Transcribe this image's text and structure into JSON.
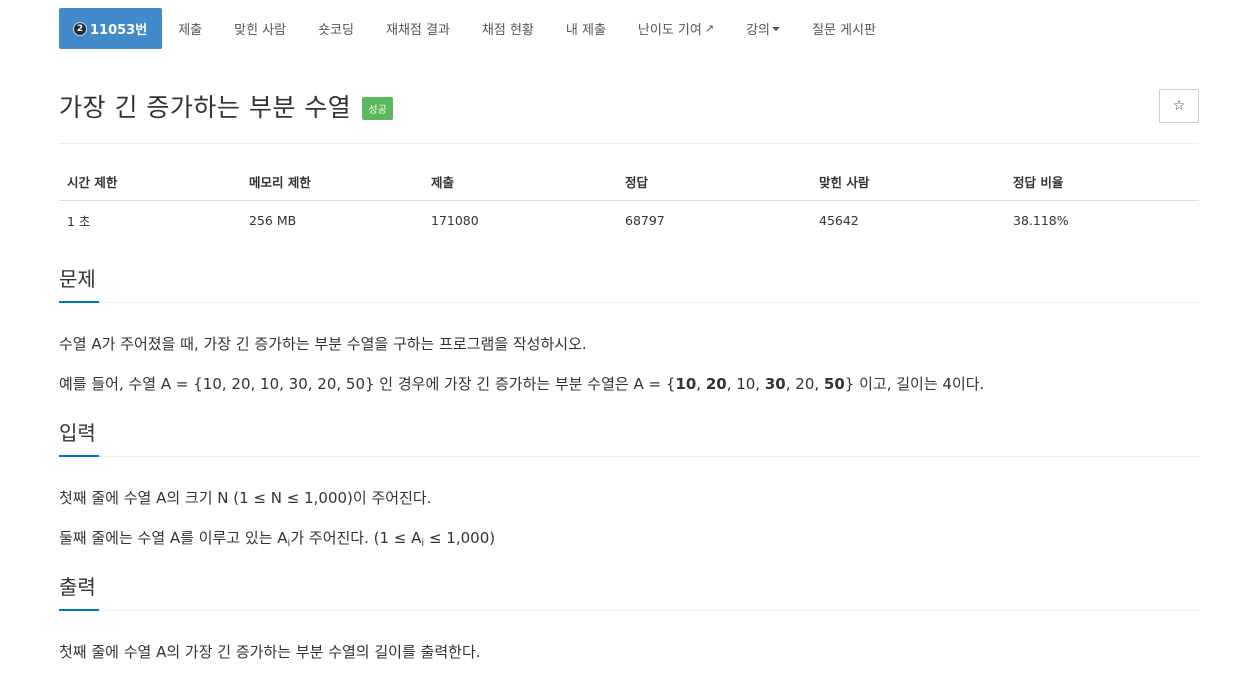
{
  "nav": {
    "problem_id": "11053번",
    "tier_icon_label": "2",
    "items": [
      "제출",
      "맞힌 사람",
      "숏코딩",
      "재채점 결과",
      "채점 현황",
      "내 제출",
      "난이도 기여",
      "강의",
      "질문 게시판"
    ]
  },
  "title": {
    "text": "가장 긴 증가하는 부분 수열",
    "badge": "성공",
    "star": "☆"
  },
  "info": {
    "headers": [
      "시간 제한",
      "메모리 제한",
      "제출",
      "정답",
      "맞힌 사람",
      "정답 비율"
    ],
    "values": [
      "1 초",
      "256 MB",
      "171080",
      "68797",
      "45642",
      "38.118%"
    ]
  },
  "problem": {
    "title": "문제",
    "line1": "수열 A가 주어졌을 때, 가장 긴 증가하는 부분 수열을 구하는 프로그램을 작성하시오.",
    "line2_prefix": "예를 들어, 수열 A = {10, 20, 10, 30, 20, 50} 인 경우에 가장 긴 증가하는 부분 수열은 A = {",
    "line2_n1": "10",
    "line2_sep1": ", ",
    "line2_n2": "20",
    "line2_sep2": ", 10, ",
    "line2_n3": "30",
    "line2_sep3": ", 20, ",
    "line2_n4": "50",
    "line2_suffix": "} 이고, 길이는 4이다."
  },
  "input": {
    "title": "입력",
    "line1": "첫째 줄에 수열 A의 크기 N (1 ≤ N ≤ 1,000)이 주어진다.",
    "line2_a": "둘째 줄에는 수열 A를 이루고 있는 A",
    "line2_sub1": "i",
    "line2_b": "가 주어진다. (1 ≤ A",
    "line2_sub2": "i",
    "line2_c": " ≤ 1,000)"
  },
  "output": {
    "title": "출력",
    "line1": "첫째 줄에 수열 A의 가장 긴 증가하는 부분 수열의 길이를 출력한다."
  },
  "colors": {
    "nav_active": "#428bca",
    "badge_success": "#5cb85c",
    "section_accent": "#0076c0"
  }
}
